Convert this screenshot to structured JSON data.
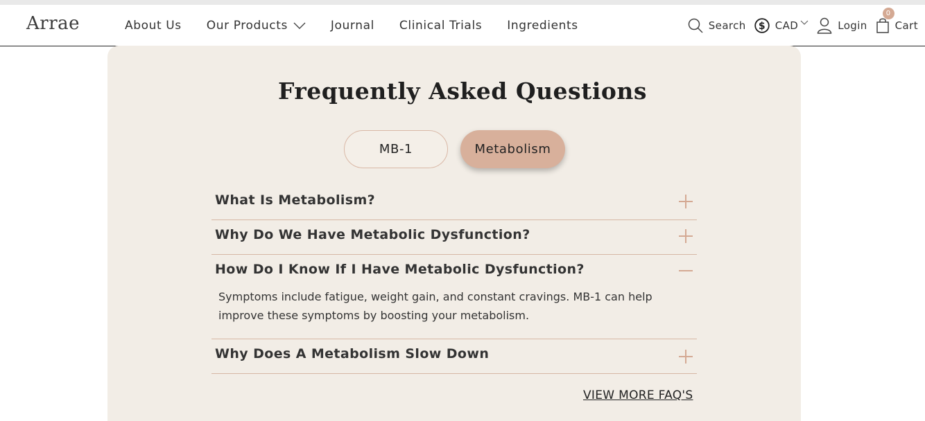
{
  "brand": {
    "logo": "Arrae"
  },
  "nav": {
    "items": [
      {
        "label": "About Us"
      },
      {
        "label": "Our Products"
      },
      {
        "label": "Journal"
      },
      {
        "label": "Clinical Trials"
      },
      {
        "label": "Ingredients"
      }
    ]
  },
  "utility": {
    "search_label": "Search",
    "currency_label": "CAD",
    "login_label": "Login",
    "cart_label": "Cart",
    "cart_count": "0"
  },
  "faq": {
    "title": "Frequently Asked Questions",
    "tabs": [
      {
        "label": "MB-1",
        "active": false
      },
      {
        "label": "Metabolism",
        "active": true
      }
    ],
    "items": [
      {
        "question": "What Is Metabolism?",
        "expanded": false
      },
      {
        "question": "Why Do We Have Metabolic Dysfunction?",
        "expanded": false
      },
      {
        "question": "How Do I Know If I Have Metabolic Dysfunction?",
        "expanded": true,
        "answer": "Symptoms include fatigue, weight gain, and constant cravings. MB-1 can help improve these symptoms by boosting your metabolism."
      },
      {
        "question": "Why Does A Metabolism Slow Down",
        "expanded": false
      }
    ],
    "view_more": "VIEW MORE FAQ'S"
  },
  "colors": {
    "accent": "#d8b09b",
    "card_bg": "#f2ede6",
    "divider": "#d6b7a4",
    "icon": "#d4a993"
  }
}
